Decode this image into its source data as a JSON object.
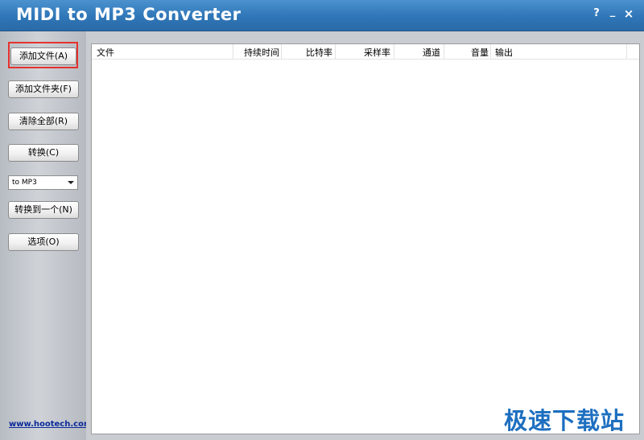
{
  "window": {
    "title": "MIDI to MP3 Converter",
    "controls": {
      "help": "?",
      "minimize": "_",
      "close": "×"
    }
  },
  "sidebar": {
    "buttons": [
      {
        "label": "添加文件(A)"
      },
      {
        "label": "添加文件夹(F)"
      },
      {
        "label": "清除全部(R)"
      },
      {
        "label": "转换(C)"
      },
      {
        "label": "转换到一个(N)"
      },
      {
        "label": "选项(O)"
      }
    ],
    "format_select": {
      "selected": "to MP3"
    },
    "website": "www.hootech.com"
  },
  "file_list": {
    "columns": [
      "文件",
      "持续时间",
      "比特率",
      "采样率",
      "通道",
      "音量",
      "输出"
    ],
    "rows": []
  },
  "watermark": "极速下载站",
  "colors": {
    "titlebar": "#2f76b8",
    "highlight": "#e5322d",
    "link": "#0a2a9a",
    "watermark": "#1e6fc0"
  }
}
